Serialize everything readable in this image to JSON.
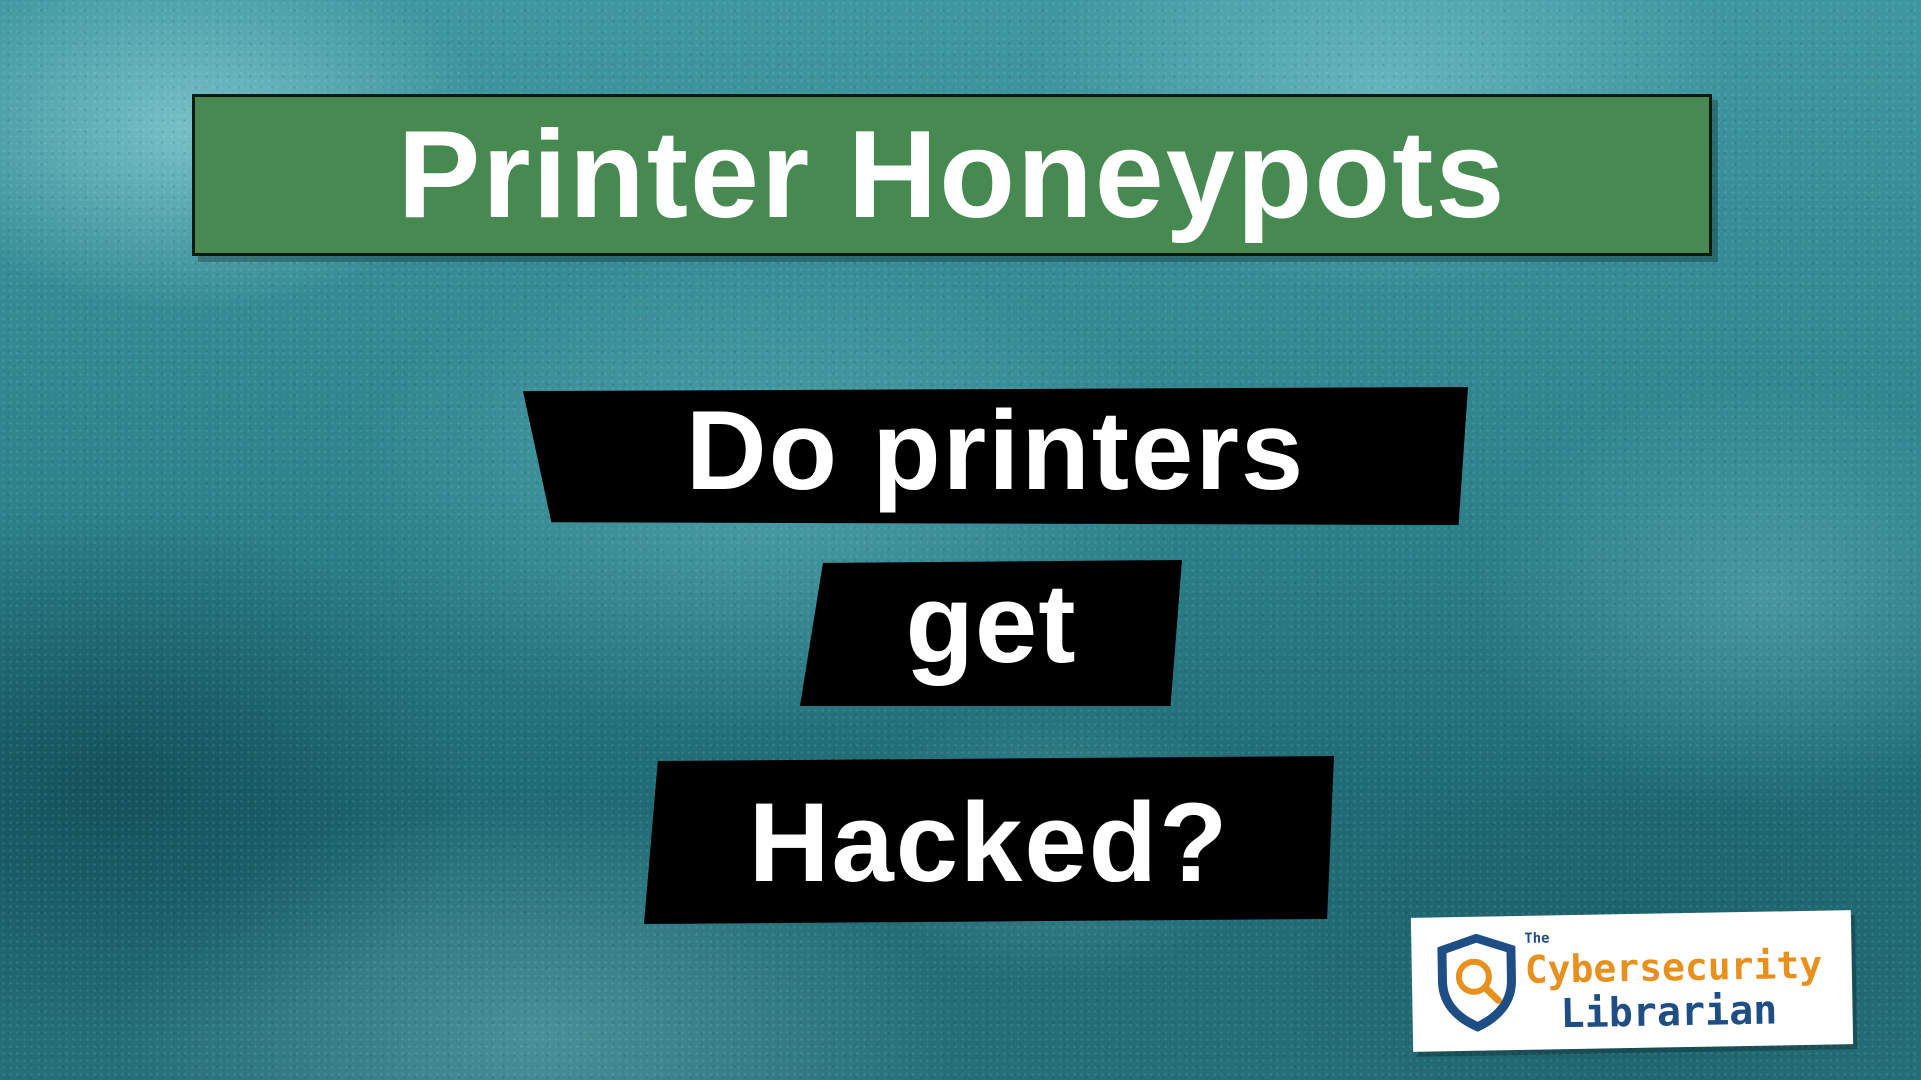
{
  "title": "Printer Honeypots",
  "question_lines": [
    "Do printers",
    "get",
    "Hacked?"
  ],
  "logo": {
    "the": "The",
    "name_line_1": "Cybersecurity",
    "name_line_2": "Librarian",
    "icon": "shield-magnifier-icon"
  },
  "colors": {
    "title_background": "#468a52",
    "question_background": "#000000",
    "text": "#ffffff",
    "logo_orange": "#e8901e",
    "logo_blue": "#1f4e85",
    "background_teal": "#2f7f86"
  }
}
